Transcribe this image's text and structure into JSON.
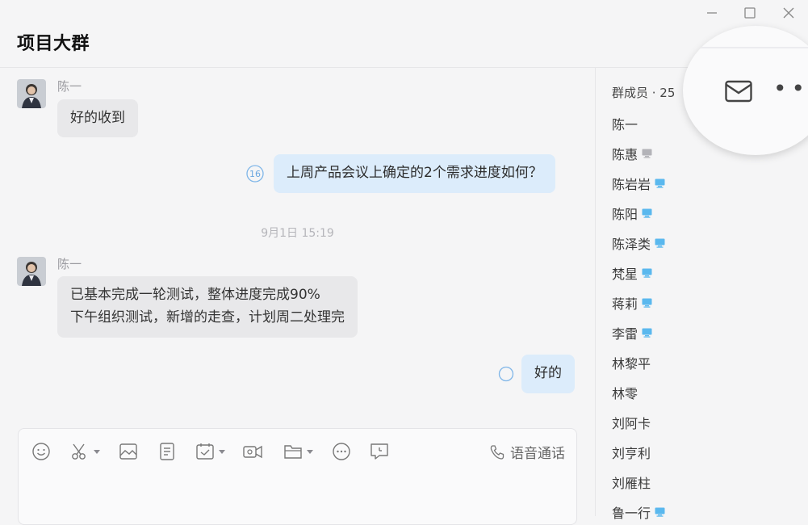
{
  "window": {
    "title": "项目大群",
    "controls": [
      "minimize-icon",
      "maximize-icon",
      "close-icon"
    ]
  },
  "messages": [
    {
      "direction": "in",
      "sender": "陈一",
      "lines": [
        "好的收到"
      ]
    },
    {
      "direction": "out",
      "read_count": "16",
      "lines": [
        "上周产品会议上确定的2个需求进度如何？"
      ]
    },
    {
      "direction": "in",
      "sender": "陈一",
      "lines": [
        "已基本完成一轮测试，整体进度完成90%",
        "下午组织测试，新增的走查，计划周二处理完"
      ]
    },
    {
      "direction": "out",
      "read_count": "",
      "lines": [
        "好的"
      ]
    }
  ],
  "timestamp": "9月1日 15:19",
  "composer": {
    "tools": [
      "emoji-icon",
      "scissors-icon",
      "image-icon",
      "document-icon",
      "task-icon",
      "video-icon",
      "folder-icon",
      "more-icon",
      "chat-record-icon"
    ],
    "voice_call_label": "语音通话"
  },
  "members": {
    "header": "群成员 · 25",
    "list": [
      {
        "name": "陈一",
        "device": ""
      },
      {
        "name": "陈惠",
        "device": "offline"
      },
      {
        "name": "陈岩岩",
        "device": "online"
      },
      {
        "name": "陈阳",
        "device": "online"
      },
      {
        "name": "陈泽类",
        "device": "online"
      },
      {
        "name": "梵星",
        "device": "online"
      },
      {
        "name": "蒋莉",
        "device": "online"
      },
      {
        "name": "李雷",
        "device": "online"
      },
      {
        "name": "林黎平",
        "device": ""
      },
      {
        "name": "林零",
        "device": ""
      },
      {
        "name": "刘阿卡",
        "device": ""
      },
      {
        "name": "刘亨利",
        "device": ""
      },
      {
        "name": "刘雁柱",
        "device": ""
      },
      {
        "name": "鲁一行",
        "device": "online"
      }
    ]
  },
  "toolbar_zoom": {
    "icons": [
      "mail-icon",
      "more-options-icon"
    ]
  },
  "colors": {
    "outgoing_bubble": "#dcecfb",
    "incoming_bubble": "#e8e8ea",
    "online_device": "#5ab8ee",
    "offline_device": "#b3b3b8"
  }
}
